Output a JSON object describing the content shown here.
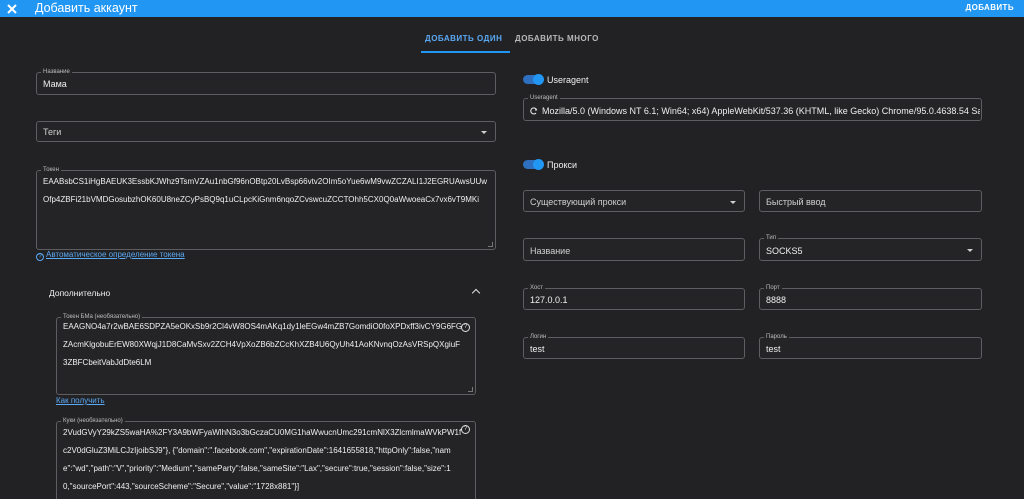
{
  "header": {
    "title": "Добавить аккаунт",
    "action_label": "ДОБАВИТЬ"
  },
  "tabs": [
    {
      "label": "ДОБАВИТЬ ОДИН"
    },
    {
      "label": "ДОБАВИТЬ МНОГО"
    }
  ],
  "form": {
    "name": {
      "label": "Название",
      "value": "Мама"
    },
    "tags": {
      "placeholder": "Теги"
    },
    "token": {
      "label": "Токен",
      "value": "EAABsbCS1iHgBAEUK3EssbKJWhz9TsmVZAu1nbGf96nOBtp20LvBsp66vtv2OIm5oYue6wM9vwZCZALI1J2EGRUAwsUUwOfp4ZBFi21bVMDGosubzhOK60U8neZCyPsBQ9q1uCLpcKiGnm6nqoZCvswcuZCCTOhh5CX0Q0aWwoeaCx7vx6vT9MKi",
      "auto_link": "Автоматическое определение токена"
    },
    "additional": {
      "title": "Дополнительно",
      "bm_token": {
        "label": "Токен БМа (необязательно)",
        "value": "EAAGNO4a7r2wBAE6SDPZA5eOKxSb9r2Cl4vW8OS4mAKq1dy1leEGw4mZB7GomdiO0foXPDxff3ivCY9G6FGZAcmKlgobuErEW80XWqjJ1D8CaMvSxv2ZCH4VpXoZB6bZCcKhXZB4U6QyUh41AoKNvnqOzAsVRSpQXgiuF3ZBFCbeitVabJdDte6LM"
      },
      "get_link": "Как получить",
      "cookies": {
        "label": "Куки (необязательно)",
        "value": "2VudGVyY29kZS5waHA%2FY3A9bWFyaWlhN3o3bGczaCU0MG1haWwucnUmc291cmNlX3ZlcmlmaWVkPW1fc2V0dGluZ3MiLCJzIjoibSJ9\"}, {\"domain\":\".facebook.com\",\"expirationDate\":1641655818,\"httpOnly\":false,\"name\":\"wd\",\"path\":\"\\/\",\"priority\":\"Medium\",\"sameParty\":false,\"sameSite\":\"Lax\",\"secure\":true,\"session\":false,\"size\":10,\"sourcePort\":443,\"sourceScheme\":\"Secure\",\"value\":\"1728x881\"}]"
      }
    },
    "useragent": {
      "toggle_label": "Useragent",
      "field_label": "Useragent",
      "value": "Mozilla/5.0 (Windows NT 6.1; Win64; x64) AppleWebKit/537.36 (KHTML, like Gecko) Chrome/95.0.4638.54 Safari/537.36"
    },
    "proxy": {
      "toggle_label": "Прокси",
      "existing_placeholder": "Существующий прокси",
      "quick_input_placeholder": "Быстрый ввод",
      "name_placeholder": "Название",
      "type": {
        "label": "Тип",
        "value": "SOCKS5"
      },
      "host": {
        "label": "Хост",
        "value": "127.0.0.1"
      },
      "port": {
        "label": "Порт",
        "value": "8888"
      },
      "login": {
        "label": "Логин",
        "value": "test"
      },
      "password": {
        "label": "Пароль",
        "value": "test"
      }
    }
  },
  "colors": {
    "appbar": "#2196f3",
    "background": "#222224",
    "accent": "#5aa9f5"
  }
}
